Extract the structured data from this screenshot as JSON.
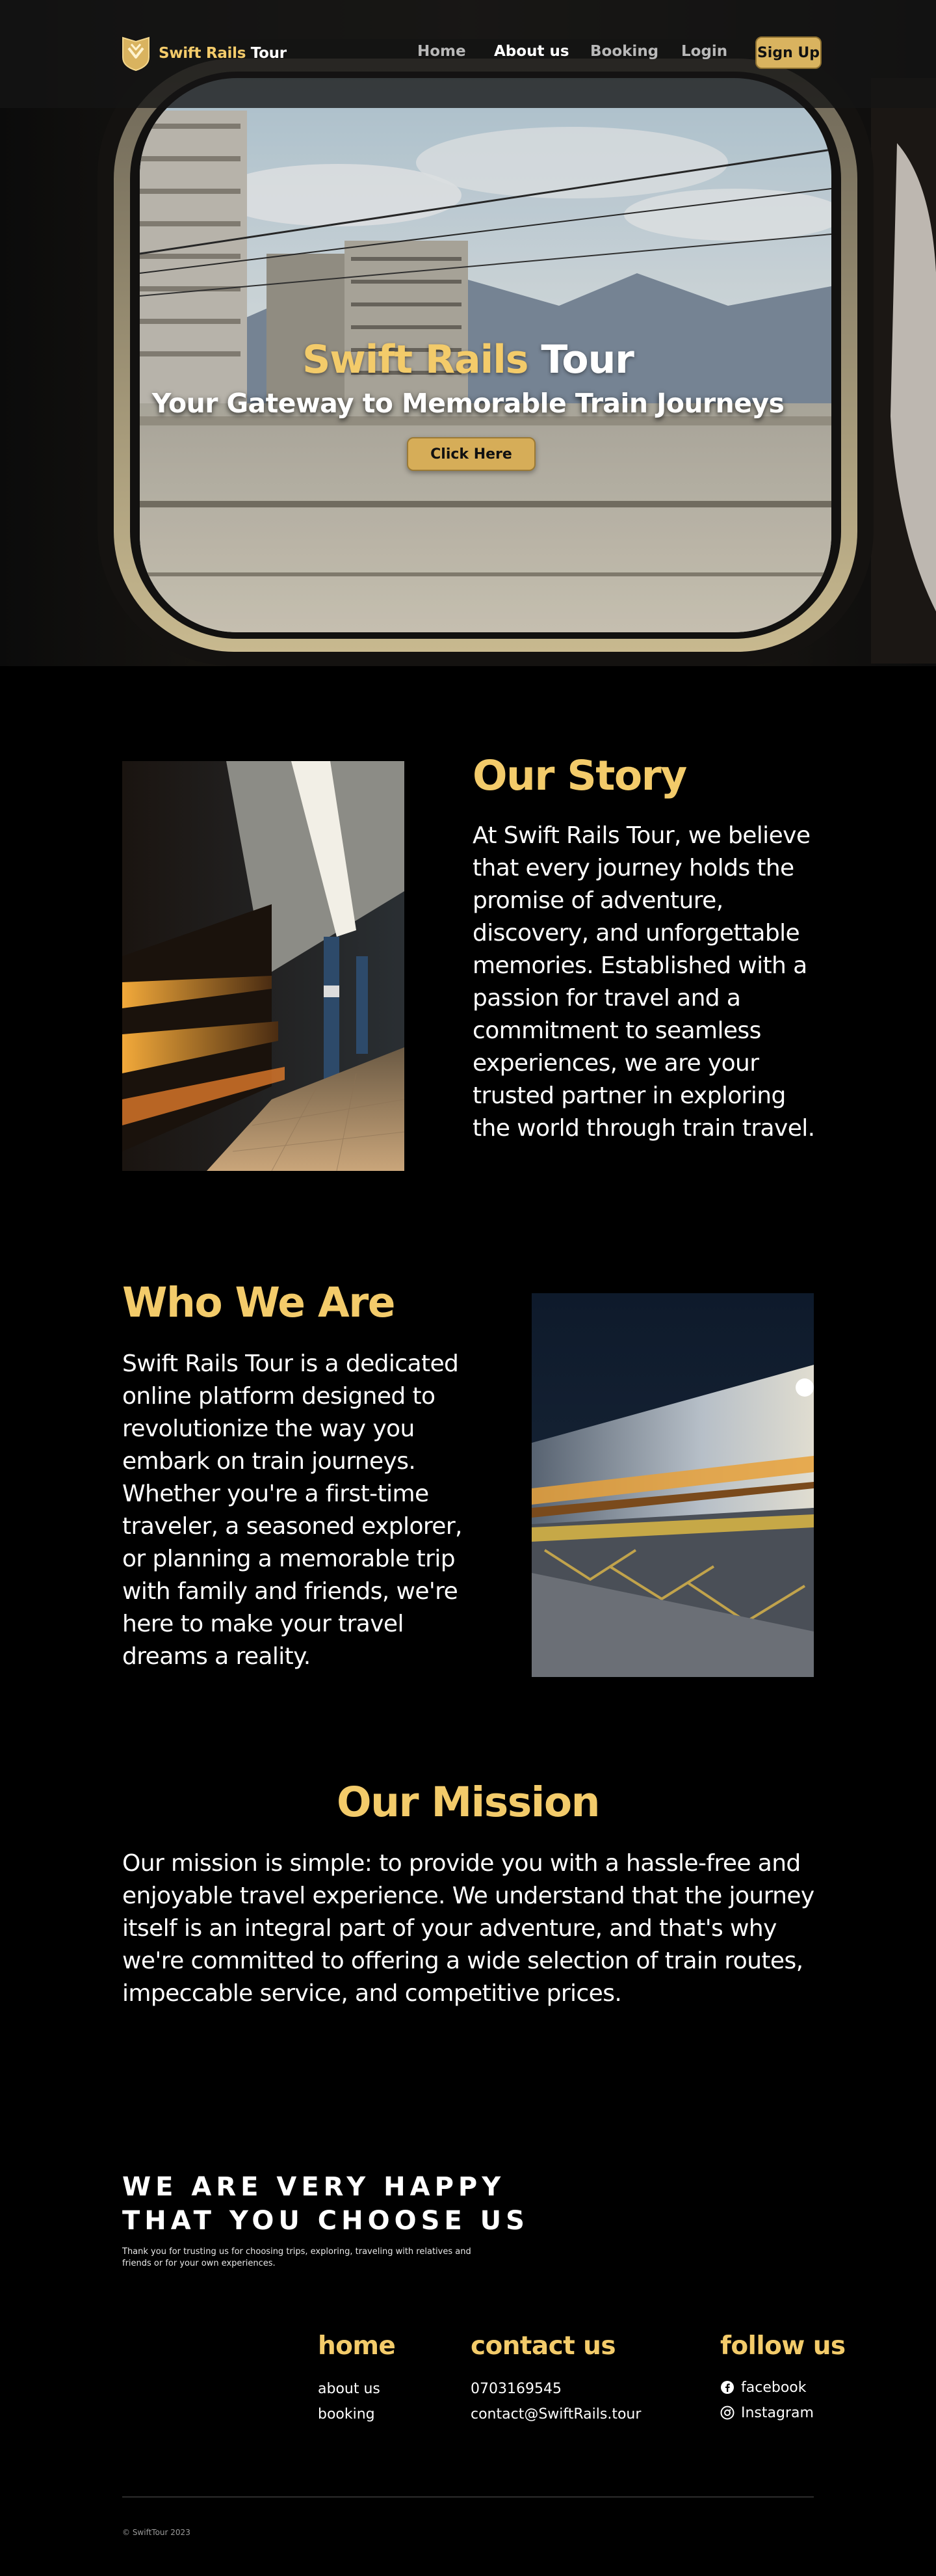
{
  "brand": {
    "name_gold": "Swift Rails",
    "name_white": " Tour"
  },
  "nav": {
    "links": [
      {
        "label": "Home",
        "active": false
      },
      {
        "label": "About us",
        "active": true
      },
      {
        "label": "Booking",
        "active": false
      },
      {
        "label": "Login",
        "active": false
      }
    ],
    "signup_label": "Sign Up"
  },
  "hero": {
    "title_gold": "Swift Rails",
    "title_white": " Tour",
    "subtitle": "Your Gateway to Memorable Train Journeys",
    "button_label": "Click Here"
  },
  "story": {
    "title": "Our Story",
    "text": "At Swift Rails Tour, we believe that every journey holds the promise of adventure, discovery, and unforgettable memories. Established with a passion for travel and a commitment to seamless experiences, we are your trusted partner in exploring the world through train travel."
  },
  "who": {
    "title": "Who We Are",
    "text": "Swift Rails Tour is a dedicated online platform designed to revolutionize the way you embark on train journeys. Whether you're a first-time traveler, a seasoned explorer, or planning a memorable trip with family and friends, we're here to make your travel dreams a reality."
  },
  "mission": {
    "title": "Our Mission",
    "text": "Our mission is simple: to provide you with a hassle-free and enjoyable travel experience. We understand that the journey itself is an integral part of your adventure, and that's why we're committed to offering a wide selection of train routes, impeccable service, and competitive prices."
  },
  "happy": {
    "line1": "WE ARE VERY HAPPY",
    "line2": "THAT YOU CHOOSE US",
    "subtitle": "Thank you for trusting us for choosing trips, exploring, traveling with relatives and friends or for your own experiences."
  },
  "footer": {
    "home_title": "home",
    "home_links": [
      "about us",
      "booking"
    ],
    "contact_title": "contact us",
    "phone": "0703169545",
    "email": "contact@SwiftRails.tour",
    "follow_title": "follow us",
    "social": [
      {
        "label": "facebook",
        "icon": "facebook-icon"
      },
      {
        "label": "Instagram",
        "icon": "instagram-icon"
      }
    ],
    "copyright": "© SwiftTour 2023"
  },
  "colors": {
    "accent": "#f3cb6a",
    "button": "#d6ad58",
    "background": "#000000"
  }
}
